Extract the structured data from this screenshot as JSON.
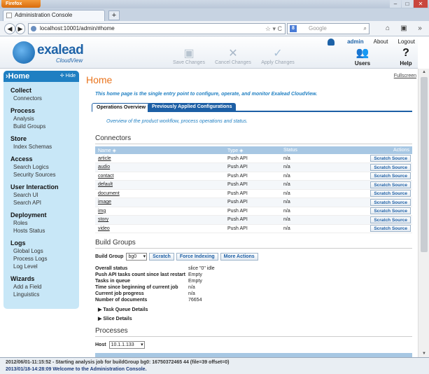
{
  "browser": {
    "menu_label": "Firefox",
    "tab_title": "Administration Console",
    "new_tab_symbol": "+",
    "url": "localhost:10001/admin/#home",
    "search_placeholder": "Google",
    "window_controls": [
      "–",
      "□",
      "✕"
    ]
  },
  "header": {
    "user": "admin",
    "about": "About",
    "logout": "Logout",
    "logo_word": "exalead",
    "logo_sub": "CloudView",
    "save_changes": "Save Changes",
    "cancel_changes": "Cancel Changes",
    "apply_changes": "Apply Changes",
    "users": "Users",
    "help": "Help"
  },
  "sidebar": {
    "home": "Home",
    "hide": "Hide",
    "sections": [
      {
        "title": "Collect",
        "items": [
          "Connectors"
        ]
      },
      {
        "title": "Process",
        "items": [
          "Analysis",
          "Build Groups"
        ]
      },
      {
        "title": "Store",
        "items": [
          "Index Schemas"
        ]
      },
      {
        "title": "Access",
        "items": [
          "Search Logics",
          "Security Sources"
        ]
      },
      {
        "title": "User Interaction",
        "items": [
          "Search UI",
          "Search API"
        ]
      },
      {
        "title": "Deployment",
        "items": [
          "Roles",
          "Hosts Status"
        ]
      },
      {
        "title": "Logs",
        "items": [
          "Global Logs",
          "Process Logs",
          "Log Level"
        ]
      },
      {
        "title": "Wizards",
        "items": [
          "Add a Field",
          "Linguistics"
        ]
      }
    ]
  },
  "main": {
    "title": "Home",
    "fullscreen": "Fullscreen",
    "intro": "This home page is the single entry point to configure, operate, and monitor Exalead CloudView.",
    "tab_overview": "Operations Overview",
    "tab_previous": "Previously Applied Configurations",
    "overview_text": "Overview of the product workflow, process operations and status.",
    "connectors_title": "Connectors",
    "columns": {
      "name": "Name",
      "type": "Type",
      "status": "Status",
      "actions": "Actions"
    },
    "connectors": [
      {
        "name": "article",
        "type": "Push API",
        "status": "n/a",
        "action": "Scratch Source"
      },
      {
        "name": "audio",
        "type": "Push API",
        "status": "n/a",
        "action": "Scratch Source"
      },
      {
        "name": "contact",
        "type": "Push API",
        "status": "n/a",
        "action": "Scratch Source"
      },
      {
        "name": "default",
        "type": "Push API",
        "status": "n/a",
        "action": "Scratch Source"
      },
      {
        "name": "document",
        "type": "Push API",
        "status": "n/a",
        "action": "Scratch Source"
      },
      {
        "name": "image",
        "type": "Push API",
        "status": "n/a",
        "action": "Scratch Source"
      },
      {
        "name": "img",
        "type": "Push API",
        "status": "n/a",
        "action": "Scratch Source"
      },
      {
        "name": "story",
        "type": "Push API",
        "status": "n/a",
        "action": "Scratch Source"
      },
      {
        "name": "video",
        "type": "Push API",
        "status": "n/a",
        "action": "Scratch Source"
      }
    ],
    "build_groups_title": "Build Groups",
    "build_group_label": "Build Group",
    "build_group_value": "bg0",
    "scratch": "Scratch",
    "force_indexing": "Force Indexing",
    "more_actions": "More Actions",
    "status_rows": [
      {
        "k": "Overall status",
        "v": "slice \"0\" idle"
      },
      {
        "k": "Push API tasks count since last restart",
        "v": "Empty"
      },
      {
        "k": "Tasks in queue",
        "v": "Empty"
      },
      {
        "k": "Time since beginning of current job",
        "v": "n/a"
      },
      {
        "k": "Current job progress",
        "v": "n/a"
      },
      {
        "k": "Number of documents",
        "v": "76654"
      }
    ],
    "task_queue_details": "Task Queue Details",
    "slice_details": "Slice Details",
    "processes_title": "Processes",
    "host_label": "Host",
    "host_value": "10.1.1.133"
  },
  "log": {
    "line1": "2012/06/01-11:15:52 - Starting analysis job for buildGroup bg0: 16750372465 44 (file=39 offset=0)",
    "line2": "2013/01/18-14:28:09 Welcome to the Administration Console."
  }
}
